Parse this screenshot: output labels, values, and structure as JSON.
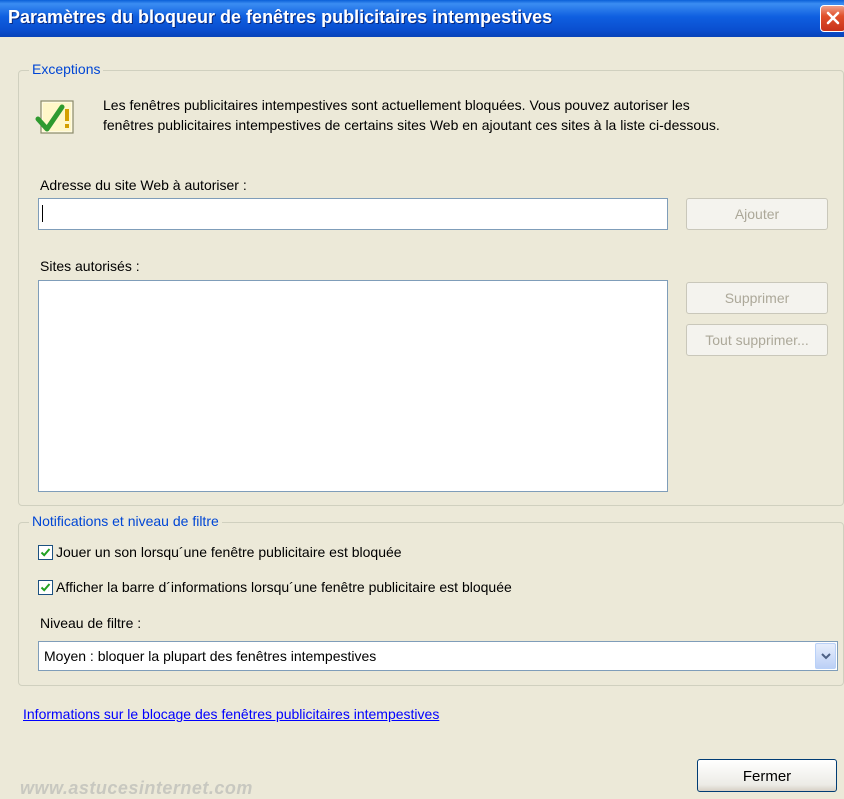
{
  "window": {
    "title": "Paramètres du bloqueur de fenêtres publicitaires intempestives"
  },
  "exceptions": {
    "legend": "Exceptions",
    "intro_line1": "Les fenêtres publicitaires intempestives sont actuellement bloquées.  Vous pouvez autoriser les",
    "intro_line2": "fenêtres publicitaires intempestives de certains sites Web en ajoutant ces sites à la liste ci-dessous.",
    "address_label": "Adresse du site Web à autoriser :",
    "address_value": "",
    "add_label": "Ajouter",
    "sites_label": "Sites autorisés :",
    "sites": [],
    "remove_label": "Supprimer",
    "remove_all_label": "Tout supprimer..."
  },
  "notifications": {
    "legend": "Notifications et niveau de filtre",
    "play_sound_label": "Jouer un son lorsqu´une fenêtre publicitaire est bloquée",
    "play_sound_checked": true,
    "show_bar_label": "Afficher la barre d´informations lorsqu´une fenêtre publicitaire est bloquée",
    "show_bar_checked": true,
    "filter_label": "Niveau de filtre :",
    "filter_value": "Moyen : bloquer la plupart des fenêtres intempestives"
  },
  "footer": {
    "help_link": "Informations sur le blocage des fenêtres publicitaires intempestives",
    "close_label": "Fermer",
    "watermark": "www.astucesinternet.com"
  },
  "colors": {
    "accent": "#0046d5",
    "link": "#0000ff",
    "background": "#ece9d8"
  }
}
